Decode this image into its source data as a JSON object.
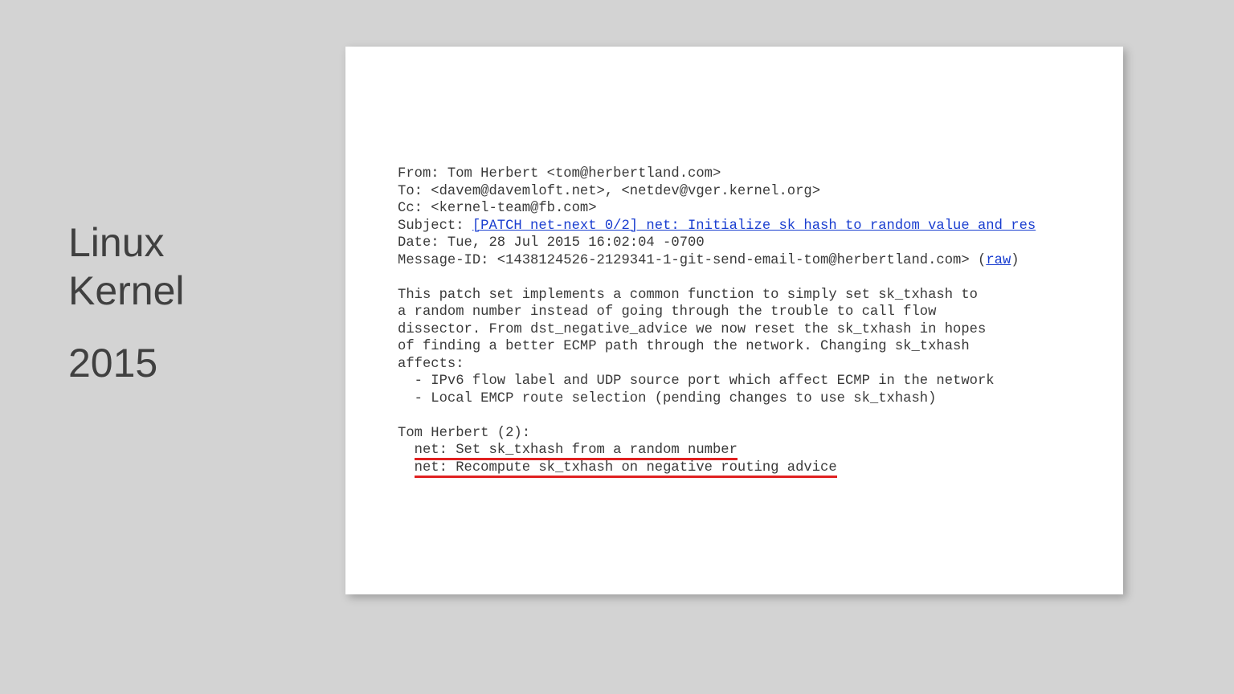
{
  "sidebar": {
    "title_line1": "Linux",
    "title_line2": "Kernel",
    "year": "2015"
  },
  "email": {
    "from_label": "From: ",
    "from_value": "Tom Herbert <tom@herbertland.com>",
    "to_label": "To: ",
    "to_value": "<davem@davemloft.net>, <netdev@vger.kernel.org>",
    "cc_label": "Cc: ",
    "cc_value": "<kernel-team@fb.com>",
    "subject_label": "Subject: ",
    "subject_link": "[PATCH net-next 0/2] net: Initialize sk_hash to random value and res",
    "date_label": "Date: ",
    "date_value": "Tue, 28 Jul 2015 16:02:04 -0700",
    "msgid_label": "Message-ID: ",
    "msgid_value": "<1438124526-2129341-1-git-send-email-tom@herbertland.com>",
    "raw_open": " (",
    "raw_link": "raw",
    "raw_close": ")",
    "body_p1_l1": "This patch set implements a common function to simply set sk_txhash to",
    "body_p1_l2": "a random number instead of going through the trouble to call flow",
    "body_p1_l3": "dissector. From dst_negative_advice we now reset the sk_txhash in hopes",
    "body_p1_l4": "of finding a better ECMP path through the network. Changing sk_txhash",
    "body_p1_l5": "affects:",
    "body_b1": "  - IPv6 flow label and UDP source port which affect ECMP in the network",
    "body_b2": "  - Local EMCP route selection (pending changes to use sk_txhash)",
    "author_line": "Tom Herbert (2):",
    "patch1_prefix": "  ",
    "patch1_text": "net: Set sk_txhash from a random number",
    "patch2_prefix": "  ",
    "patch2_text": "net: Recompute sk_txhash on negative routing advice"
  }
}
